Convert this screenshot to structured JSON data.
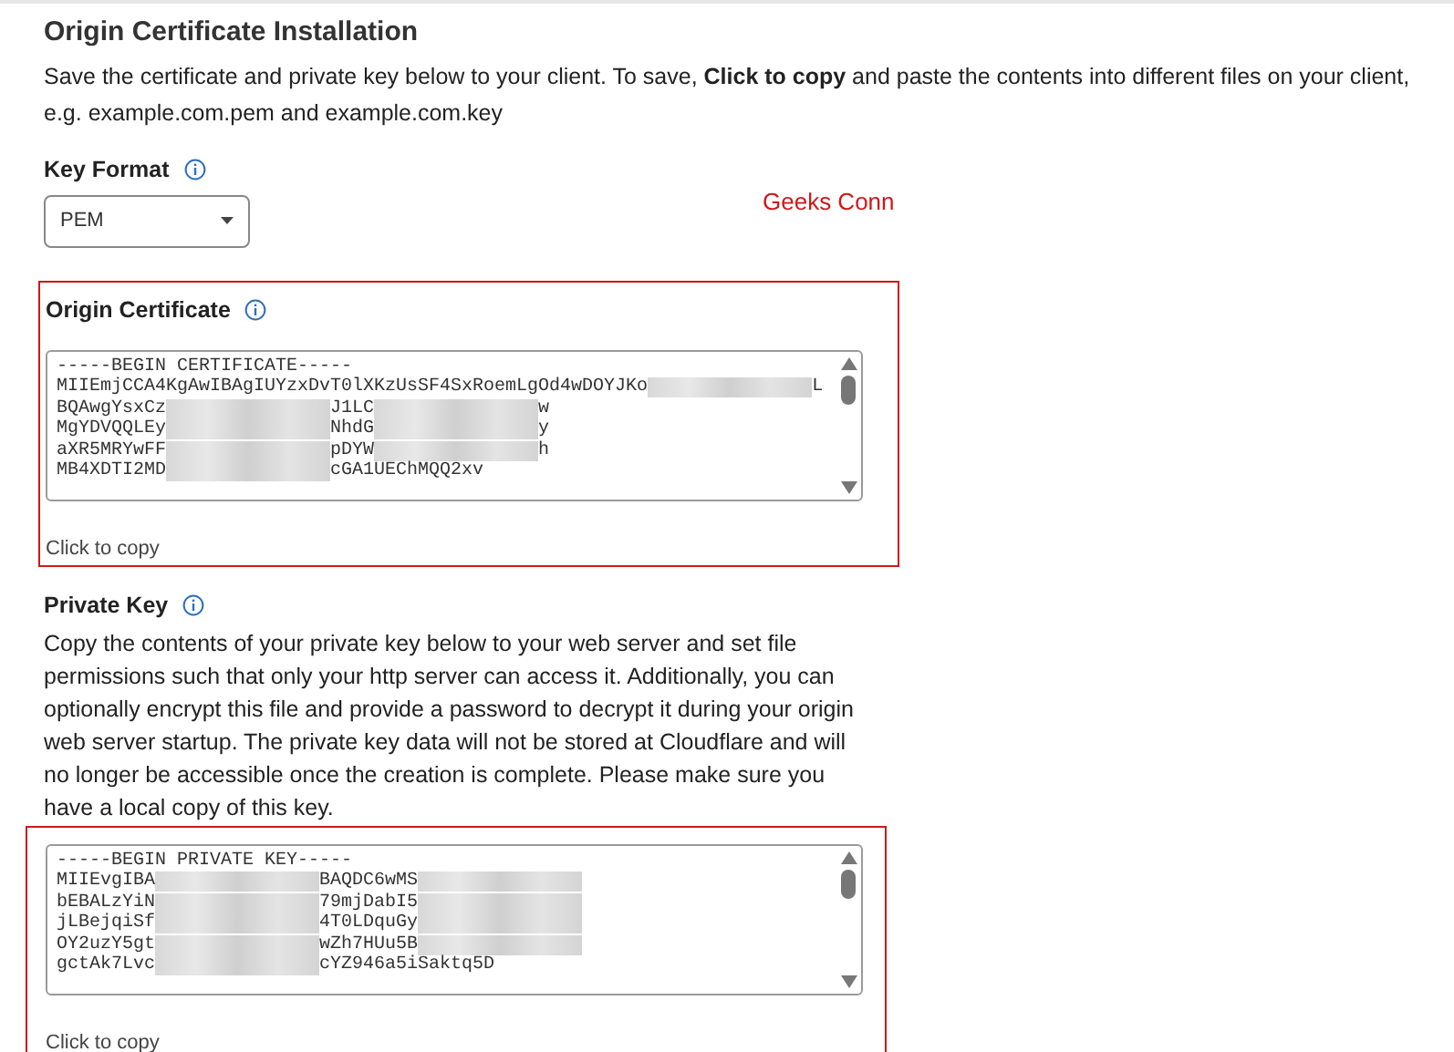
{
  "title": "Origin Certificate Installation",
  "description": "Save the certificate and private key below to your client. To save, **Click to copy** and paste the contents into different files on your client, e.g. example.com.pem and example.com.key",
  "key_format": {
    "label": "Key Format",
    "value": "PEM"
  },
  "annotation": "Geeks Conn",
  "certificate": {
    "label": "Origin Certificate",
    "copy": "Click to copy",
    "lines": [
      [
        {
          "kind": "text",
          "text": "-----BEGIN CERTIFICATE-----"
        }
      ],
      [
        {
          "kind": "text",
          "text": "MIIEmjCCA4KgAwIBAgIUYzxDvT0lXKzUsSF4SxRoemLgOd4wDOYJKo"
        },
        {
          "kind": "redacted"
        },
        {
          "kind": "text",
          "text": "L"
        }
      ],
      [
        {
          "kind": "text",
          "text": "BQAwgYsxCz"
        },
        {
          "kind": "redacted"
        },
        {
          "kind": "text",
          "text": "J1LC"
        },
        {
          "kind": "redacted"
        },
        {
          "kind": "text",
          "text": "w"
        }
      ],
      [
        {
          "kind": "text",
          "text": "MgYDVQQLEy"
        },
        {
          "kind": "redacted"
        },
        {
          "kind": "text",
          "text": "NhdG"
        },
        {
          "kind": "redacted"
        },
        {
          "kind": "text",
          "text": "y"
        }
      ],
      [
        {
          "kind": "text",
          "text": "aXR5MRYwFF"
        },
        {
          "kind": "redacted"
        },
        {
          "kind": "text",
          "text": "pDYW"
        },
        {
          "kind": "redacted"
        },
        {
          "kind": "text",
          "text": "h"
        }
      ],
      [
        {
          "kind": "text",
          "text": "MB4XDTI2MD"
        },
        {
          "kind": "redacted"
        },
        {
          "kind": "text",
          "text": "cGA1UEChMQQ2xv"
        }
      ]
    ]
  },
  "private_key": {
    "label": "Private Key",
    "description": "Copy the contents of your private key below to your web server and set file permissions such that only your http server can access it. Additionally, you can optionally encrypt this file and provide a password to decrypt it during your origin web server startup. The private key data will not be stored at Cloudflare and will no longer be accessible once the creation is complete. Please make sure you have a local copy of this key.",
    "copy": "Click to copy",
    "lines": [
      [
        {
          "kind": "text",
          "text": "-----BEGIN PRIVATE KEY-----"
        }
      ],
      [
        {
          "kind": "text",
          "text": "MIIEvgIBA"
        },
        {
          "kind": "redacted"
        },
        {
          "kind": "text",
          "text": "BAQDC6wMS"
        },
        {
          "kind": "redacted"
        }
      ],
      [
        {
          "kind": "text",
          "text": "bEBALzYiN"
        },
        {
          "kind": "redacted"
        },
        {
          "kind": "text",
          "text": "79mjDabI5"
        },
        {
          "kind": "redacted"
        }
      ],
      [
        {
          "kind": "text",
          "text": "jLBejqiSf"
        },
        {
          "kind": "redacted"
        },
        {
          "kind": "text",
          "text": "4T0LDquGy"
        },
        {
          "kind": "redacted"
        }
      ],
      [
        {
          "kind": "text",
          "text": "OY2uzY5gt"
        },
        {
          "kind": "redacted"
        },
        {
          "kind": "text",
          "text": "wZh7HUu5B"
        },
        {
          "kind": "redacted"
        }
      ],
      [
        {
          "kind": "text",
          "text": "gctAk7Lvc"
        },
        {
          "kind": "redacted"
        },
        {
          "kind": "text",
          "text": "cYZ946a5iSaktq5D"
        }
      ]
    ]
  }
}
